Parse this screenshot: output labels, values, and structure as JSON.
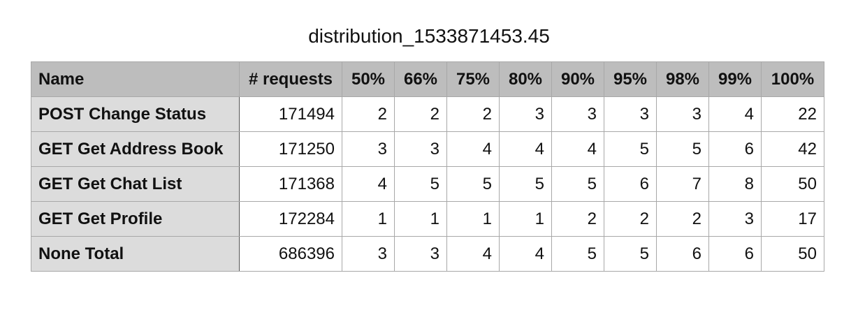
{
  "title": "distribution_1533871453.45",
  "table": {
    "columns": [
      "Name",
      "# requests",
      "50%",
      "66%",
      "75%",
      "80%",
      "90%",
      "95%",
      "98%",
      "99%",
      "100%"
    ],
    "rows": [
      {
        "name": "POST Change Status",
        "cells": [
          "171494",
          "2",
          "2",
          "2",
          "3",
          "3",
          "3",
          "3",
          "4",
          "22"
        ]
      },
      {
        "name": "GET Get Address Book",
        "cells": [
          "171250",
          "3",
          "3",
          "4",
          "4",
          "4",
          "5",
          "5",
          "6",
          "42"
        ]
      },
      {
        "name": "GET Get Chat List",
        "cells": [
          "171368",
          "4",
          "5",
          "5",
          "5",
          "5",
          "6",
          "7",
          "8",
          "50"
        ]
      },
      {
        "name": "GET Get Profile",
        "cells": [
          "172284",
          "1",
          "1",
          "1",
          "1",
          "2",
          "2",
          "2",
          "3",
          "17"
        ]
      },
      {
        "name": "None Total",
        "cells": [
          "686396",
          "3",
          "3",
          "4",
          "4",
          "5",
          "5",
          "6",
          "6",
          "50"
        ]
      }
    ]
  },
  "colors": {
    "header_bg": "#bdbdbd",
    "name_col_bg": "#dcdcdc",
    "border": "#a8a8a8"
  }
}
